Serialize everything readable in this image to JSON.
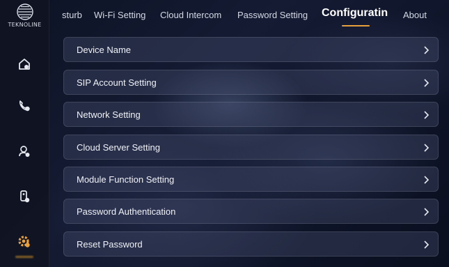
{
  "app": {
    "brand": "TEKNOLINE"
  },
  "sidebar": {
    "items": [
      {
        "icon": "home-icon",
        "label": ""
      },
      {
        "icon": "call-icon",
        "label": ""
      },
      {
        "icon": "user-settings-icon",
        "label": ""
      },
      {
        "icon": "device-icon",
        "label": ""
      },
      {
        "icon": "settings-gear-icon",
        "label": "",
        "active": true
      }
    ]
  },
  "tabs": [
    {
      "label": "sturb"
    },
    {
      "label": "Wi-Fi Setting"
    },
    {
      "label": "Cloud Intercom"
    },
    {
      "label": "Password Setting"
    },
    {
      "label": "Configuratin",
      "active": true
    },
    {
      "label": "About"
    }
  ],
  "menu": {
    "items": [
      {
        "label": "Device Name"
      },
      {
        "label": "SIP Account Setting"
      },
      {
        "label": "Network Setting"
      },
      {
        "label": "Cloud Server Setting"
      },
      {
        "label": "Module Function Setting"
      },
      {
        "label": "Password Authentication"
      },
      {
        "label": "Reset Password"
      }
    ]
  },
  "colors": {
    "accent": "#e8a13a",
    "sidebar_bg": "#10141f",
    "row_bg": "#46506e"
  }
}
